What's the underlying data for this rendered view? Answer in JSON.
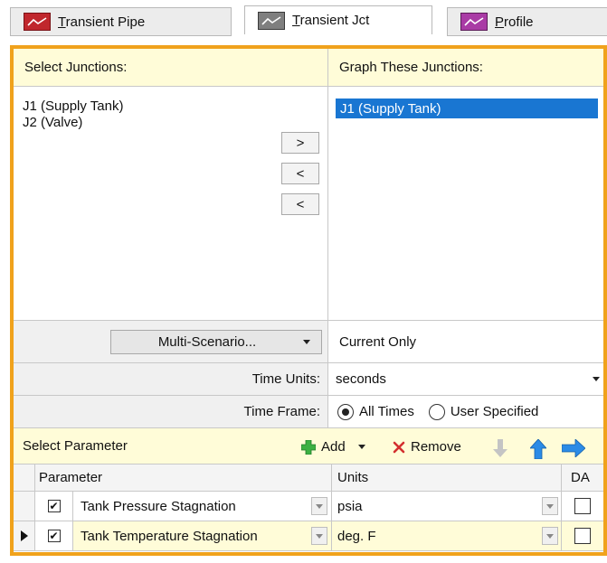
{
  "tabs": [
    {
      "underline": "T",
      "rest": "ransient Pipe",
      "color": "#c0272d"
    },
    {
      "underline": "T",
      "rest": "ransient Jct",
      "color": "#7f7f7f"
    },
    {
      "underline": "P",
      "rest": "rofile",
      "color": "#a93ba5"
    }
  ],
  "junctions": {
    "select_header": "Select Junctions:",
    "graph_header": "Graph These Junctions:",
    "available": [
      "J1 (Supply Tank)",
      "J2 (Valve)"
    ],
    "selected": [
      "J1 (Supply Tank)"
    ],
    "buttons": [
      ">",
      "<",
      "<"
    ]
  },
  "scenario": {
    "button_label": "Multi-Scenario...",
    "value": "Current Only"
  },
  "time_units": {
    "label": "Time Units:",
    "value": "seconds"
  },
  "time_frame": {
    "label": "Time Frame:",
    "options": [
      "All Times",
      "User Specified"
    ],
    "selected": "All Times"
  },
  "parameters": {
    "header": "Select Parameter",
    "add_label": "Add",
    "remove_label": "Remove",
    "columns": [
      "Parameter",
      "Units",
      "DA"
    ],
    "rows": [
      {
        "parameter": "Tank Pressure Stagnation",
        "units": "psia",
        "checked": true,
        "da": false
      },
      {
        "parameter": "Tank Temperature Stagnation",
        "units": "deg. F",
        "checked": true,
        "da": false
      }
    ]
  },
  "colors": {
    "accent_border": "#f0a21c",
    "header_bg": "#fffcd8",
    "selection": "#1976d2",
    "add_icon": "#3cb043",
    "remove_icon": "#d32f2f",
    "arrow_icon": "#2b8be6"
  }
}
